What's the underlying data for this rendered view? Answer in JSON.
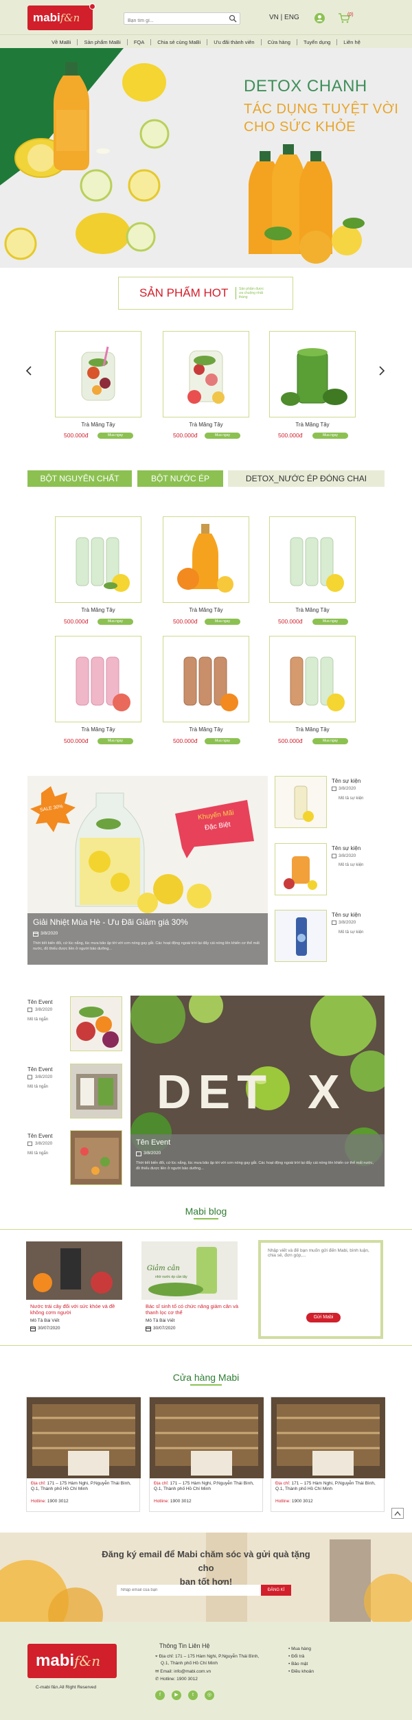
{
  "header": {
    "logo_main": "mabi",
    "logo_sub": "f&n",
    "search_placeholder": "Bạn tìm gì...",
    "lang": "VN | ENG",
    "cart_count": "(0)"
  },
  "nav": [
    "Về MaBi",
    "Sản phẩm MaBi",
    "FQA",
    "Chia sẻ cùng MaBi",
    "Ưu đãi thành viên",
    "Cửa hàng",
    "Tuyển dụng",
    "Liên hệ"
  ],
  "hero": {
    "line1": "DETOX CHANH",
    "line2": "TÁC DỤNG TUYỆT VỜI",
    "line3": "CHO SỨC KHỎE",
    "colors": {
      "title": "#3f8f5a",
      "subtitle": "#e8a52a"
    }
  },
  "hot": {
    "title": "SẢN PHẨM HOT",
    "subtitle": "Sản phẩm được ưa chuộng nhất tháng"
  },
  "hot_products": [
    {
      "name": "Trà Măng Tây",
      "price": "500.000đ",
      "buy": "Mua ngay"
    },
    {
      "name": "Trà Măng Tây",
      "price": "500.000đ",
      "buy": "Mua ngay"
    },
    {
      "name": "Trà Măng Tây",
      "price": "500.000đ",
      "buy": "Mua ngay"
    }
  ],
  "categories": [
    "BỘT NGUYÊN CHẤT",
    "BỘT NƯỚC ÉP",
    "DETOX_NƯỚC ÉP ĐÓNG CHAI"
  ],
  "products": [
    {
      "name": "Trà Măng Tây",
      "price": "500.000đ",
      "buy": "Mua ngay"
    },
    {
      "name": "Trà Măng Tây",
      "price": "500.000đ",
      "buy": "Mua ngay"
    },
    {
      "name": "Trà Măng Tây",
      "price": "500.000đ",
      "buy": "Mua ngay"
    },
    {
      "name": "Trà Măng Tây",
      "price": "500.000đ",
      "buy": "Mua ngay"
    },
    {
      "name": "Trà Măng Tây",
      "price": "500.000đ",
      "buy": "Mua ngay"
    },
    {
      "name": "Trà Măng Tây",
      "price": "500.000đ",
      "buy": "Mua ngay"
    }
  ],
  "promo": {
    "badge": "SALE 30%",
    "banner1": "Khuyến Mãi",
    "banner2": "Đặc Biệt",
    "title": "Giải Nhiệt Mùa Hè - Ưu Đãi Giảm giá 30%",
    "date": "3/8/2020",
    "desc": "Thời tiết biến đổi, cứ lúc nắng, lúc mưa bão ập tới với cơn nóng gay gắt. Các hoạt động ngoài trời lại đẩy cái nóng lên khiến cơ thể mất nước, đồ thiếu được liền ở người bảo dưỡng... "
  },
  "events_right": [
    {
      "title": "Tên sự kiện",
      "date": "3/8/2020",
      "desc": "Mô tả sự kiện"
    },
    {
      "title": "Tên sự kiện",
      "date": "3/8/2020",
      "desc": "Mô tả sự kiện"
    },
    {
      "title": "Tên sự kiện",
      "date": "3/8/2020",
      "desc": "Mô tả sự kiện"
    }
  ],
  "events_left": [
    {
      "title": "Tên Event",
      "date": "3/8/2020",
      "desc": "Mô tả ngắn"
    },
    {
      "title": "Tên Event",
      "date": "3/8/2020",
      "desc": "Mô tả ngắn"
    },
    {
      "title": "Tên Event",
      "date": "3/8/2020",
      "desc": "Mô tả ngắn"
    }
  ],
  "detox": {
    "word_left": "DET",
    "word_right": "X",
    "title": "Tên Event",
    "date": "3/8/2020",
    "desc": "Thời tiết biến đổi, cứ lúc nắng, lúc mưa bão ập tới với cơn nóng gay gắt. Các hoạt động ngoài trời lại đẩy cái nóng lên khiến cơ thể mất nước, đồ thiếu được liền ở người bảo dưỡng..."
  },
  "blog": {
    "title": "Mabi blog",
    "posts": [
      {
        "title": "Nước trái cây đổi với sức khỏe và đề không cơm người",
        "desc": "Mô Tả Bài Viết",
        "date": "30/07/2020"
      },
      {
        "title": "Bác sĩ sinh tố có chức năng giảm cân và thanh lọc cơ thể",
        "desc": "Mô Tả Bài Viết",
        "date": "30/07/2020"
      }
    ],
    "image2_text1": "Giảm cân",
    "image2_text2": "nhờ nước ép cần tây",
    "contact_placeholder": "Nhập viết và để bạn muốn gửi đến Mabi, bình luận, chia sẻ, đơn góp,...",
    "send": "Gửi Mabi"
  },
  "stores": {
    "title": "Cửa hàng Mabi",
    "items": [
      {
        "addr_label": "Địa chỉ:",
        "addr": "171 – 175 Hàm Nghi, P.Nguyễn Thái Bình, Q.1, Thành phố Hồ Chí Minh",
        "hotline_label": "Hotline:",
        "hotline": "1900 3012"
      },
      {
        "addr_label": "Địa chỉ:",
        "addr": "171 – 175 Hàm Nghi, P.Nguyễn Thái Bình, Q.1, Thành phố Hồ Chí Minh",
        "hotline_label": "Hotline:",
        "hotline": "1900 3012"
      },
      {
        "addr_label": "Địa chỉ:",
        "addr": "171 – 175 Hàm Nghi, P.Nguyễn Thái Bình, Q.1, Thành phố Hồ Chí Minh",
        "hotline_label": "Hotline:",
        "hotline": "1900 3012"
      }
    ]
  },
  "newsletter": {
    "line1": "Đăng ký email để Mabi chăm sóc và gửi quà tặng cho",
    "line2": "bạn tốt hơn!",
    "placeholder": "Nhập email của bạn",
    "button": "ĐĂNG KÍ"
  },
  "footer": {
    "logo_main": "mabi",
    "logo_sub": "f&n",
    "copyright": "C-mabi f&n.All Right Reserved",
    "contact_title": "Thông Tin Liên Hệ",
    "address": "Địa chỉ: 171 – 175 Hàm Nghi, P.Nguyễn Thái Bình,",
    "address2": "Q.1, Thành phố Hồ Chí Minh",
    "email": "Email: info@mabi.com.vn",
    "hotline": "Hotline: 1900 3012",
    "links": [
      "Mua hàng",
      "Đổi trả",
      "Bảo mật",
      "Điều khoản"
    ],
    "socials": [
      "f",
      "▶",
      "t",
      "◎"
    ]
  },
  "accent_colors": {
    "red": "#d11f2b",
    "green": "#8cc152",
    "light_green": "#e8ecd7"
  }
}
